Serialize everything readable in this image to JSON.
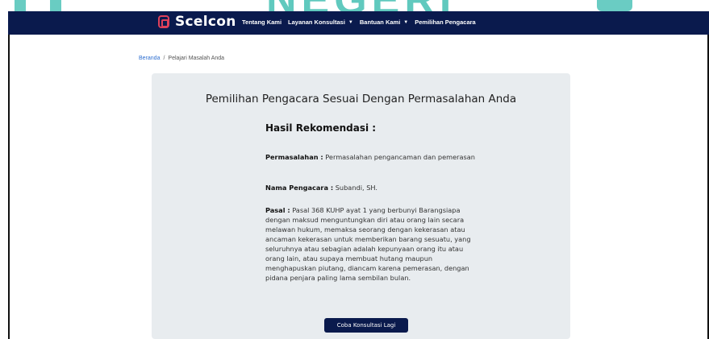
{
  "watermark": {
    "text": "NEGERI"
  },
  "brand": {
    "name": "Scelcon"
  },
  "nav": {
    "items": [
      {
        "label": "Tentang Kami",
        "dropdown": false
      },
      {
        "label": "Layanan Konsultasi",
        "dropdown": true
      },
      {
        "label": "Bantuan Kami",
        "dropdown": true
      },
      {
        "label": "Pemilihan Pengacara",
        "dropdown": false
      }
    ]
  },
  "breadcrumb": {
    "home": "Beranda",
    "separator": "/",
    "current": "Pelajari Masalah Anda"
  },
  "card": {
    "title": "Pemilihan Pengacara Sesuai Dengan Permasalahan Anda",
    "result_heading": "Hasil Rekomendasi :",
    "problem_label": "Permasalahan :",
    "problem_value": " Permasalahan pengancaman dan pemerasan",
    "lawyer_label": "Nama Pengacara :",
    "lawyer_value": " Subandi, SH.",
    "article_label": "Pasal :",
    "article_value": " Pasal 368 KUHP ayat 1 yang berbunyi Barangsiapa dengan maksud menguntungkan diri atau orang lain secara melawan hukum, memaksa seorang dengan kekerasan atau ancaman kekerasan untuk memberikan barang sesuatu, yang seluruhnya atau sebagian adalah kepunyaan orang itu atau orang lain, atau supaya membuat hutang maupun menghapuskan piutang, diancam karena pemerasan, dengan pidana penjara paling lama sembilan bulan.",
    "button_label": "Coba Konsultasi Lagi"
  },
  "colors": {
    "navbar": "#0a1a4d",
    "logo_accent": "#e0405a",
    "card_bg": "#e8ecef",
    "link": "#2f6fd0",
    "watermark": "#2bb7a9"
  }
}
